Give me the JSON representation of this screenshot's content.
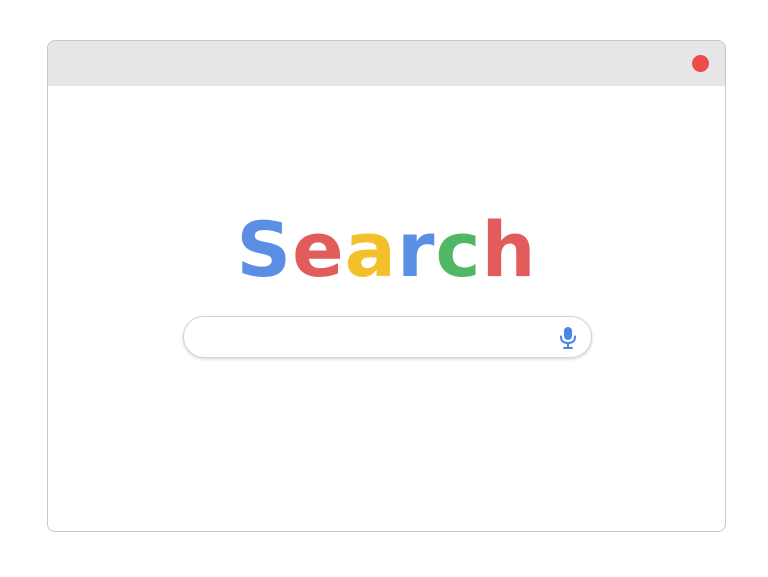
{
  "window": {
    "close_button_color": "#ee4b4b"
  },
  "logo": {
    "letters": [
      {
        "char": "S",
        "color": "#5b8fe6"
      },
      {
        "char": "e",
        "color": "#e25c5c"
      },
      {
        "char": "a",
        "color": "#f3c02c"
      },
      {
        "char": "r",
        "color": "#5b8fe6"
      },
      {
        "char": "c",
        "color": "#4fb765"
      },
      {
        "char": "h",
        "color": "#e25c5c"
      }
    ]
  },
  "search": {
    "value": "",
    "placeholder": "",
    "mic_icon": "microphone-icon",
    "mic_color": "#4a86e8"
  }
}
